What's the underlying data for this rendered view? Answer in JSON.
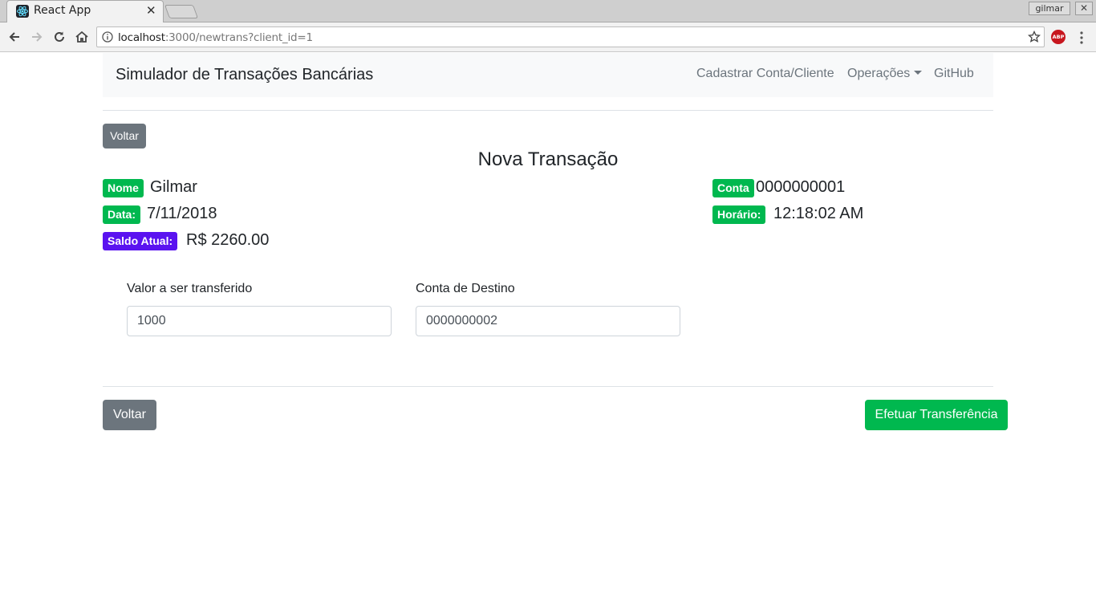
{
  "browser": {
    "tab_title": "React App",
    "tab_close": "✕",
    "profile": "gilmar",
    "window_close": "✕",
    "url_host": "localhost",
    "url_path": ":3000/newtrans?client_id=1",
    "extension_label": "ABP"
  },
  "navbar": {
    "brand": "Simulador de Transações Bancárias",
    "links": [
      "Cadastrar Conta/Cliente",
      "Operações",
      "GitHub"
    ]
  },
  "page": {
    "back_top": "Voltar",
    "title": "Nova Transação",
    "info": {
      "nome_label": "Nome",
      "nome_value": "Gilmar",
      "data_label": "Data:",
      "data_value": "7/11/2018",
      "saldo_label": "Saldo Atual:",
      "saldo_value": "R$ 2260.00",
      "conta_label": "Conta",
      "conta_value": "0000000001",
      "horario_label": "Horário:",
      "horario_value": "12:18:02 AM"
    },
    "form": {
      "valor_label": "Valor a ser transferido",
      "valor_value": "1000",
      "destino_label": "Conta de Destino",
      "destino_value": "0000000002"
    },
    "back_bottom": "Voltar",
    "submit": "Efetuar Transferência"
  },
  "colors": {
    "success": "#00b84f",
    "secondary": "#6c757d",
    "purple": "#5a13f0"
  }
}
